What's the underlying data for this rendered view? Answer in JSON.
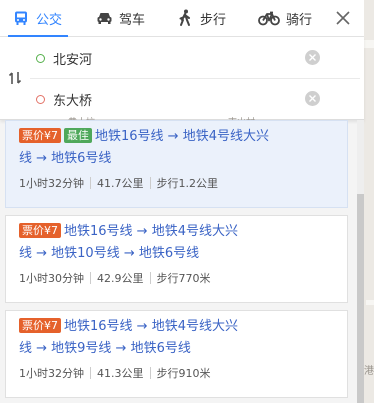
{
  "tabs": [
    {
      "label": "公交",
      "icon": "bus-icon",
      "active": true
    },
    {
      "label": "驾车",
      "icon": "car-icon",
      "active": false
    },
    {
      "label": "步行",
      "icon": "walk-icon",
      "active": false
    },
    {
      "label": "骑行",
      "icon": "bike-icon",
      "active": false
    }
  ],
  "route": {
    "start": {
      "value": "北安河",
      "color": "#55b04b"
    },
    "end": {
      "value": "东大桥",
      "color": "#e37267"
    }
  },
  "map_labels": [
    "黄土坑",
    "南山村",
    "港"
  ],
  "results": [
    {
      "price": "票价¥7",
      "best": "最佳",
      "line1": "地铁16号线 → 地铁4号线大兴",
      "line2": "线 → 地铁6号线",
      "duration": "1小时32分钟",
      "distance": "41.7公里",
      "walk": "步行1.2公里"
    },
    {
      "price": "票价¥7",
      "line1": "地铁16号线 → 地铁4号线大兴",
      "line2": "线 → 地铁10号线 → 地铁6号线",
      "duration": "1小时30分钟",
      "distance": "42.9公里",
      "walk": "步行770米"
    },
    {
      "price": "票价¥7",
      "line1": "地铁16号线 → 地铁4号线大兴",
      "line2": "线 → 地铁9号线 → 地铁6号线",
      "duration": "1小时32分钟",
      "distance": "41.3公里",
      "walk": "步行910米"
    }
  ],
  "colors": {
    "accent": "#3385ff",
    "link": "#3a63c5",
    "price_badge": "#e5612b",
    "best_badge": "#4fa85b"
  }
}
